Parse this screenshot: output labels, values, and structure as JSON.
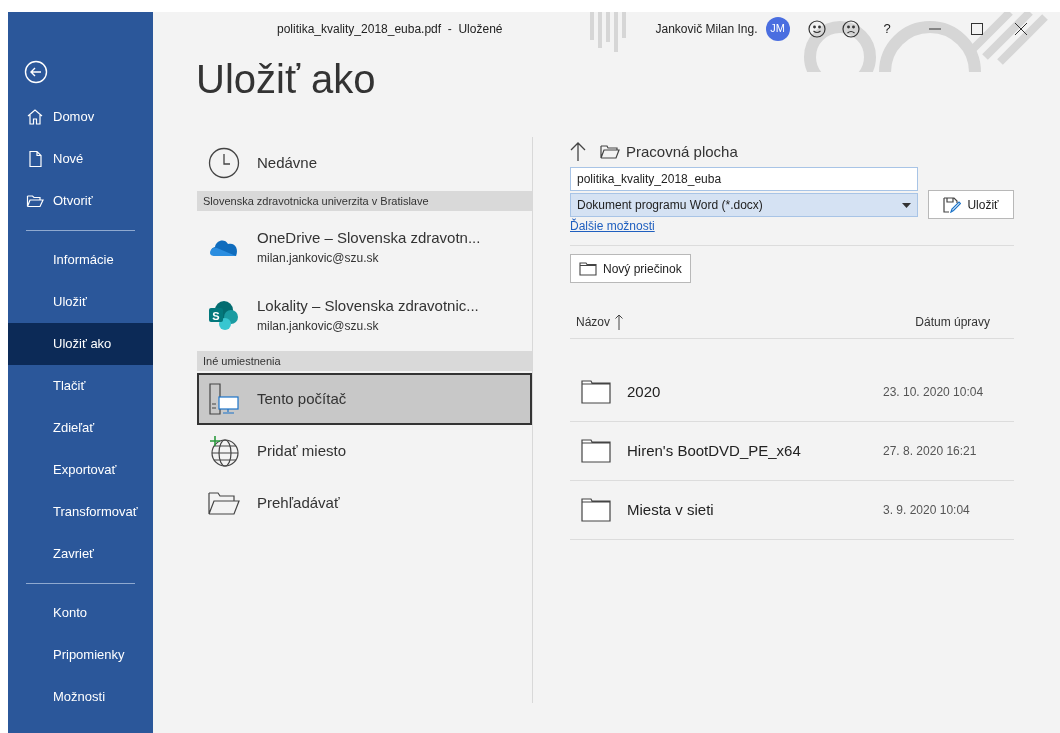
{
  "title_bar": {
    "document": "politika_kvality_2018_euba.pdf  -  Uložené",
    "user_name": "Jankovič Milan Ing.",
    "avatar_initials": "JM",
    "help": "?"
  },
  "sidebar": {
    "groups": [
      [
        {
          "label": "Domov",
          "kind": "home",
          "selected": false
        },
        {
          "label": "Nové",
          "kind": "new",
          "selected": false
        },
        {
          "label": "Otvoriť",
          "kind": "open",
          "selected": false
        }
      ],
      [
        {
          "label": "Informácie",
          "kind": "plain",
          "selected": false
        },
        {
          "label": "Uložiť",
          "kind": "plain",
          "selected": false
        },
        {
          "label": "Uložiť ako",
          "kind": "plain",
          "selected": true
        },
        {
          "label": "Tlačiť",
          "kind": "plain",
          "selected": false
        },
        {
          "label": "Zdieľať",
          "kind": "plain",
          "selected": false
        },
        {
          "label": "Exportovať",
          "kind": "plain",
          "selected": false
        },
        {
          "label": "Transformovať",
          "kind": "plain",
          "selected": false
        },
        {
          "label": "Zavrieť",
          "kind": "plain",
          "selected": false
        }
      ],
      [
        {
          "label": "Konto",
          "kind": "plain",
          "selected": false
        },
        {
          "label": "Pripomienky",
          "kind": "plain",
          "selected": false
        },
        {
          "label": "Možnosti",
          "kind": "plain",
          "selected": false
        }
      ]
    ]
  },
  "heading": "Uložiť ako",
  "locations": [
    {
      "kind": "recent",
      "label": "Nedávne",
      "selected": false
    },
    {
      "kind": "section",
      "label": "Slovenska zdravotnicka univerzita v Bratislave"
    },
    {
      "kind": "onedrive",
      "label": "OneDrive – Slovenska zdravotn...",
      "account": "milan.jankovic@szu.sk",
      "selected": false
    },
    {
      "kind": "sharepoint",
      "label": "Lokality – Slovenska zdravotnic...",
      "account": "milan.jankovic@szu.sk",
      "icon_letter": "S",
      "selected": false
    },
    {
      "kind": "section",
      "label": "Iné umiestnenia"
    },
    {
      "kind": "computer",
      "label": "Tento počítač",
      "selected": true
    },
    {
      "kind": "add",
      "label": "Pridať miesto",
      "selected": false
    },
    {
      "kind": "browse",
      "label": "Prehľadávať",
      "selected": false
    }
  ],
  "save_panel": {
    "path": "Pracovná plocha",
    "file_name": "politika_kvality_2018_euba",
    "file_type": "Dokument programu Word (*.docx)",
    "save_button": "Uložiť",
    "more_options": "Ďalšie možnosti",
    "new_folder": "Nový priečinok",
    "columns": [
      "Názov",
      "Dátum úpravy"
    ],
    "rows": [
      {
        "name": "2020",
        "modified": "23. 10. 2020 10:04"
      },
      {
        "name": "Hiren's BootDVD_PE_x64",
        "modified": "27. 8. 2020 16:21"
      },
      {
        "name": "Miesta v sieti",
        "modified": "3. 9. 2020 10:04"
      }
    ]
  }
}
